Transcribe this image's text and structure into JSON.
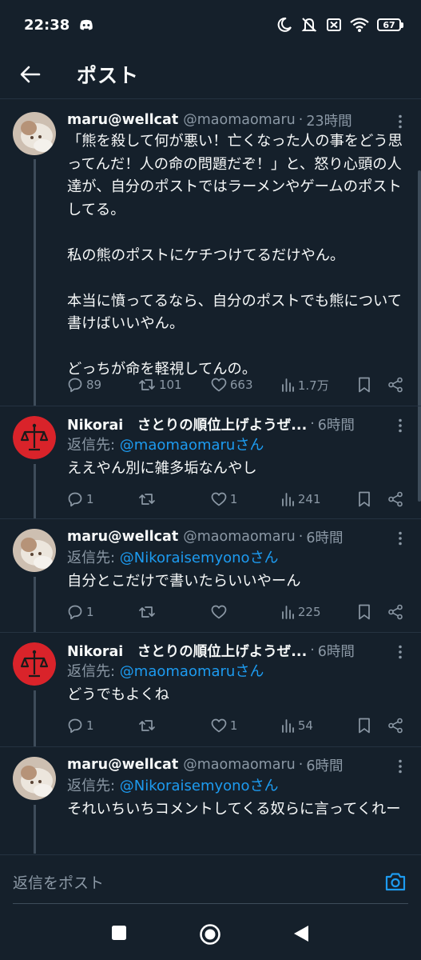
{
  "status_bar": {
    "time": "22:38",
    "battery": "67",
    "icons": [
      "discord-icon",
      "moon-icon",
      "mute-icon",
      "sim-icon",
      "wifi-icon",
      "battery-icon"
    ]
  },
  "header": {
    "back_icon": "arrow-left-icon",
    "title": "ポスト"
  },
  "posts": [
    {
      "display_name": "maru@wellcat",
      "handle": "@maomaomaru",
      "time": "23時間",
      "reply_to_prefix": "",
      "reply_to_handle": "",
      "reply_to_suffix": "",
      "text": "「熊を殺して何が悪い！亡くなった人の事をどう思ってんだ！人の命の問題だぞ！」と、怒り心頭の人達が、自分のポストではラーメンやゲームのポストしてる。\n\n私の熊のポストにケチつけてるだけやん。\n\n本当に憤ってるなら、自分のポストでも熊について書けばいいやん。\n\nどっちが命を軽視してんの。",
      "replies": "89",
      "reposts": "101",
      "likes": "663",
      "views": "1.7万"
    },
    {
      "display_name": "Nikorai　さとりの順位上げようぜ...",
      "handle": "",
      "time": "6時間",
      "reply_to_prefix": "返信先: ",
      "reply_to_handle": "@maomaomaru",
      "reply_to_suffix": "さん",
      "text": "ええやん別に雑多垢なんやし",
      "replies": "1",
      "reposts": "",
      "likes": "1",
      "views": "241"
    },
    {
      "display_name": "maru@wellcat",
      "handle": "@maomaomaru",
      "time": "6時間",
      "reply_to_prefix": "返信先: ",
      "reply_to_handle": "@Nikoraisemyono",
      "reply_to_suffix": "さん",
      "text": "自分とこだけで書いたらいいやーん",
      "replies": "1",
      "reposts": "",
      "likes": "",
      "views": "225"
    },
    {
      "display_name": "Nikorai　さとりの順位上げようぜ...",
      "handle": "",
      "time": "6時間",
      "reply_to_prefix": "返信先: ",
      "reply_to_handle": "@maomaomaru",
      "reply_to_suffix": "さん",
      "text": "どうでもよくね",
      "replies": "1",
      "reposts": "",
      "likes": "1",
      "views": "54"
    },
    {
      "display_name": "maru@wellcat",
      "handle": "@maomaomaru",
      "time": "6時間",
      "reply_to_prefix": "返信先: ",
      "reply_to_handle": "@Nikoraisemyono",
      "reply_to_suffix": "さん",
      "text": "それいちいちコメントしてくる奴らに言ってくれー",
      "replies": "",
      "reposts": "",
      "likes": "",
      "views": ""
    }
  ],
  "reply_bar": {
    "placeholder": "返信をポスト",
    "camera_icon": "camera-icon"
  },
  "nav_bar": {
    "icons": [
      "recent-apps-icon",
      "home-icon",
      "back-icon"
    ]
  },
  "colors": {
    "background": "#15202b",
    "accent": "#1d9bf0",
    "secondary_text": "#8b98a5",
    "nikorai_avatar": "#d9232a"
  }
}
